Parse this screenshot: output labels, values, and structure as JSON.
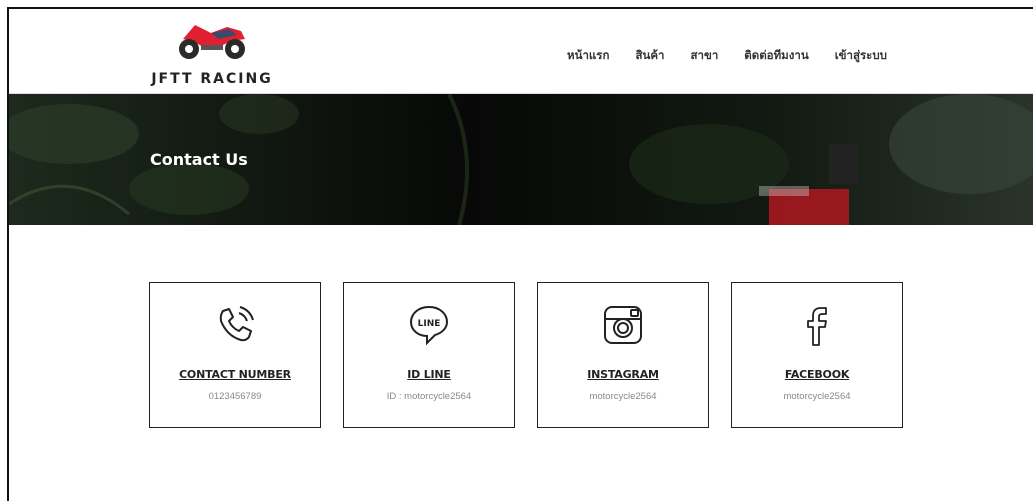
{
  "brand": {
    "name": "JFTT RACING",
    "accent": "#e02030"
  },
  "nav": {
    "items": [
      "หน้าแรก",
      "สินค้า",
      "สาขา",
      "ติดต่อทีมงาน",
      "เข้าสู่ระบบ"
    ]
  },
  "hero": {
    "title": "Contact Us"
  },
  "cards": [
    {
      "icon": "phone-icon",
      "title": "CONTACT NUMBER",
      "value": "0123456789"
    },
    {
      "icon": "line-icon",
      "title": "ID LINE",
      "value": "ID : motorcycle2564",
      "icon_text": "LINE"
    },
    {
      "icon": "instagram-icon",
      "title": "INSTAGRAM",
      "value": "motorcycle2564"
    },
    {
      "icon": "facebook-icon",
      "title": "FACEBOOK",
      "value": "motorcycle2564"
    }
  ]
}
